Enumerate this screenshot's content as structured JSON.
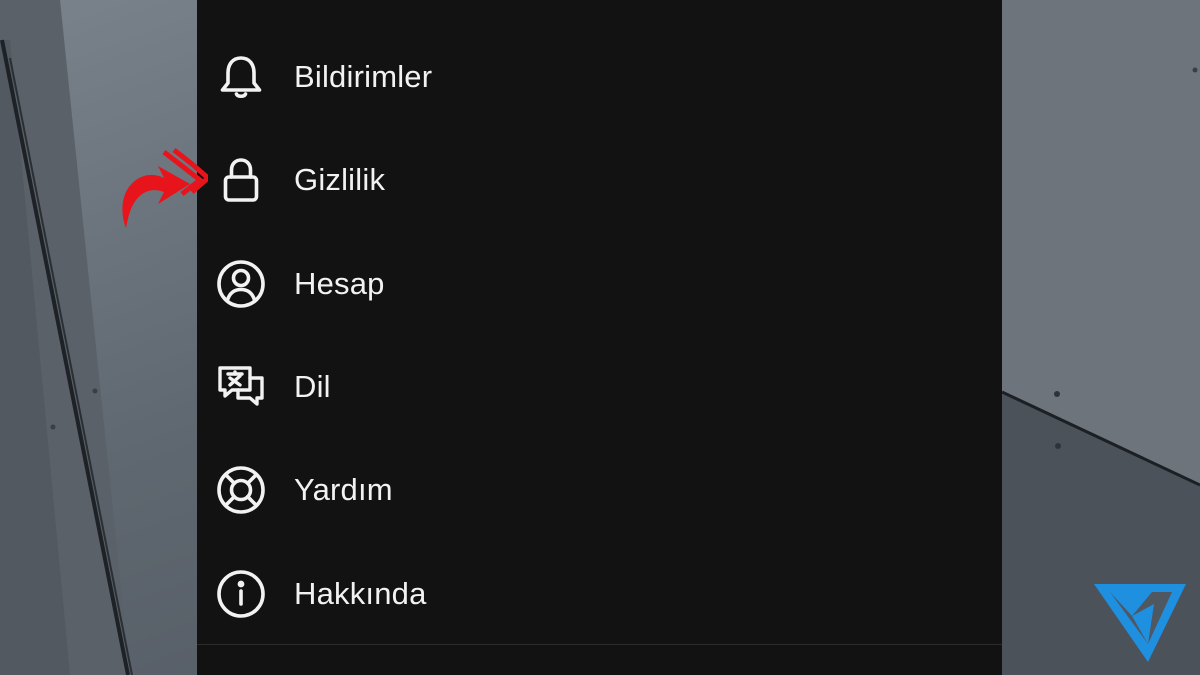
{
  "settings_menu": {
    "items": [
      {
        "id": "notifications",
        "label": "Bildirimler",
        "icon": "bell-icon"
      },
      {
        "id": "privacy",
        "label": "Gizlilik",
        "icon": "lock-icon"
      },
      {
        "id": "account",
        "label": "Hesap",
        "icon": "account-circle-icon"
      },
      {
        "id": "language",
        "label": "Dil",
        "icon": "translate-chat-icon"
      },
      {
        "id": "help",
        "label": "Yardım",
        "icon": "lifebuoy-icon"
      },
      {
        "id": "about",
        "label": "Hakkında",
        "icon": "info-icon"
      }
    ]
  },
  "annotation": {
    "highlighted_item": "privacy",
    "arrow_color": "#e8141c"
  },
  "colors": {
    "panel_background": "#121212",
    "text": "#f2f2f2",
    "brand_blue": "#1f8fe0"
  }
}
